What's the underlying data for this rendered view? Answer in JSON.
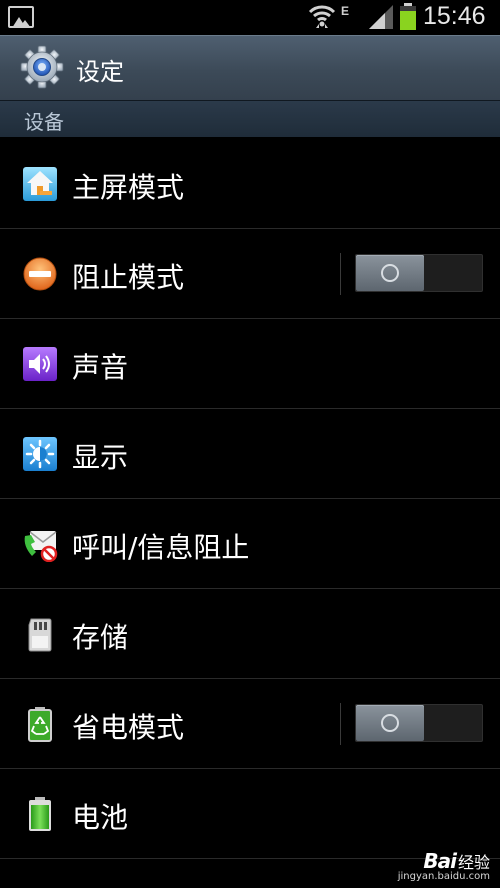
{
  "status_bar": {
    "network_type": "E",
    "time": "15:46"
  },
  "header": {
    "title": "设定",
    "icon": "gear-icon"
  },
  "section": {
    "title": "设备"
  },
  "settings_items": [
    {
      "label": "主屏模式",
      "icon": "home-screen-icon"
    },
    {
      "label": "阻止模式",
      "icon": "block-icon",
      "toggle": "off"
    },
    {
      "label": "声音",
      "icon": "speaker-icon"
    },
    {
      "label": "显示",
      "icon": "brightness-icon"
    },
    {
      "label": "呼叫/信息阻止",
      "icon": "call-message-block-icon"
    },
    {
      "label": "存储",
      "icon": "sd-card-icon"
    },
    {
      "label": "省电模式",
      "icon": "power-saving-icon",
      "toggle": "off"
    },
    {
      "label": "电池",
      "icon": "battery-icon"
    }
  ],
  "watermark": {
    "brand": "Bai",
    "brand_cn": "经验",
    "url": "jingyan.baidu.com"
  },
  "colors": {
    "title_bar": "#44525f",
    "section_header": "#25323f",
    "section_text": "#b9c7d6",
    "toggle_knob": "#6f7881"
  }
}
